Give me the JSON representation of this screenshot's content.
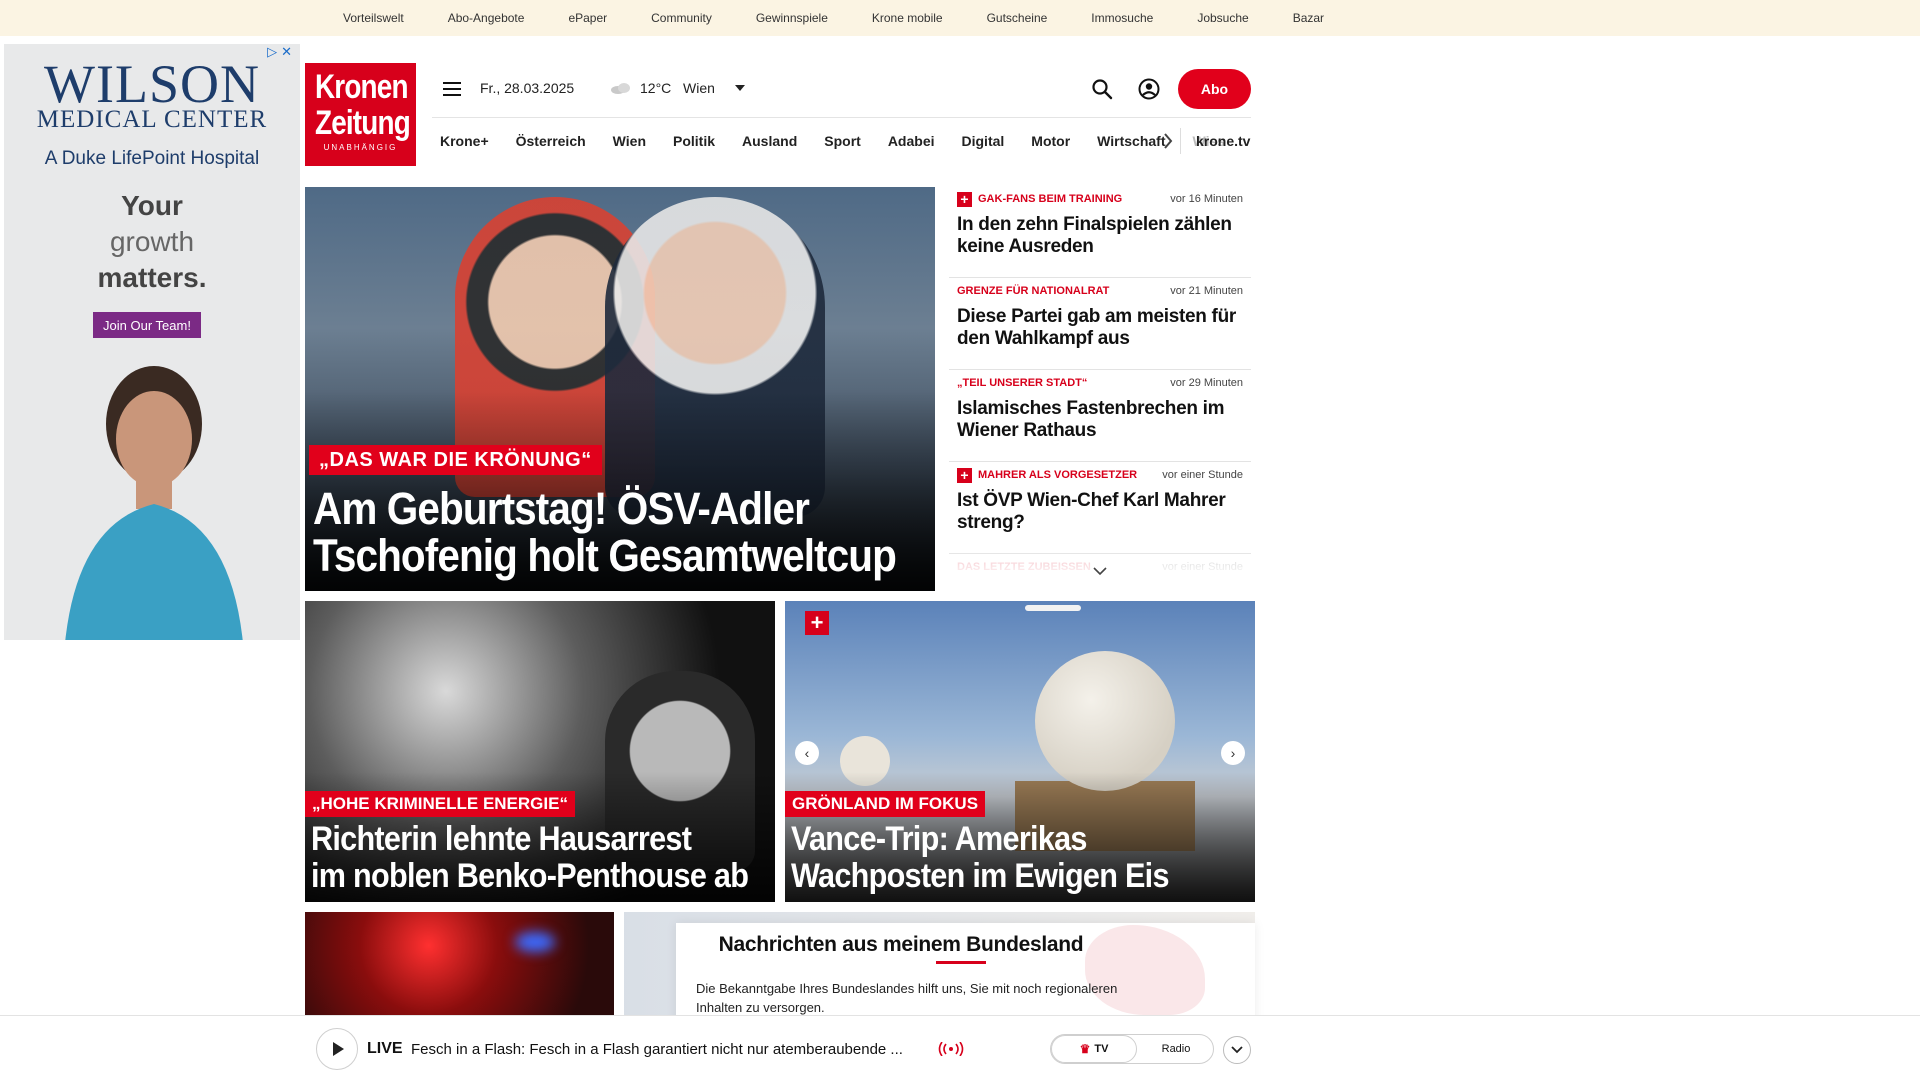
{
  "top_links": [
    "Vorteilswelt",
    "Abo-Angebote",
    "ePaper",
    "Community",
    "Gewinnspiele",
    "Krone mobile",
    "Gutscheine",
    "Immosuche",
    "Jobsuche",
    "Bazar"
  ],
  "ad": {
    "brand_line1": "WILSON",
    "brand_line2": "MEDICAL CENTER",
    "brand_line3": "A Duke LifePoint Hospital",
    "tagline_1": "Your",
    "tagline_2": "growth",
    "tagline_3": "matters.",
    "cta": "Join Our Team!",
    "close_glyphs": "▷✕"
  },
  "logo": {
    "line1": "Kronen",
    "line2": "Zeitung",
    "line3": "UNABHÄNGIG"
  },
  "header": {
    "date": "Fr., 28.03.2025",
    "temperature": "12°C",
    "city": "Wien",
    "abo_label": "Abo"
  },
  "nav": {
    "items": [
      "Krone+",
      "Österreich",
      "Wien",
      "Politik",
      "Ausland",
      "Sport",
      "Adabei",
      "Digital",
      "Motor",
      "Wirtschaft"
    ],
    "faded_item": "Wiss",
    "tv_link": "krone.tv"
  },
  "hero": {
    "kicker": "„DAS WAR DIE KRÖNUNG“",
    "headline_1": "Am Geburtstag! ÖSV-Adler",
    "headline_2": "Tschofenig holt Gesamtweltcup"
  },
  "ticker": [
    {
      "category": "GAK-FANS BEIM TRAINING",
      "plus": true,
      "time": "vor 16 Minuten",
      "title": "In den zehn Finalspielen zählen keine Ausreden"
    },
    {
      "category": "GRENZE FÜR NATIONALRAT",
      "plus": false,
      "time": "vor 21 Minuten",
      "title": "Diese Partei gab am meisten für den Wahlkampf aus"
    },
    {
      "category": "„TEIL UNSERER STADT“",
      "plus": false,
      "time": "vor 29 Minuten",
      "title": "Islamisches Fastenbrechen im Wiener Rathaus"
    },
    {
      "category": "MAHRER ALS VORGESETZER",
      "plus": true,
      "time": "vor einer Stunde",
      "title": "Ist ÖVP Wien-Chef Karl Mahrer streng?"
    },
    {
      "category": "DAS LETZTE ZUBEISSEN",
      "plus": false,
      "time": "vor einer Stunde",
      "title": ""
    }
  ],
  "tiles": [
    {
      "kicker": "„HOHE KRIMINELLE ENERGIE“",
      "headline_1": "Richterin lehnte Hausarrest",
      "headline_2": "im noblen Benko-Penthouse ab"
    },
    {
      "kicker": "GRÖNLAND IM FOKUS",
      "headline_1": "Vance-Trip: Amerikas",
      "headline_2": "Wachposten im Ewigen Eis",
      "plus_glyph": "+"
    }
  ],
  "carousel": {
    "prev": "‹",
    "next": "›"
  },
  "bundesland": {
    "title": "Nachrichten aus meinem Bundesland",
    "text": "Die Bekanntgabe Ihres Bundeslandes hilft uns, Sie mit noch regionaleren Inhalten zu versorgen."
  },
  "livebar": {
    "live_label": "LIVE",
    "text": "Fesch in a Flash: Fesch in a Flash garantiert nicht nur atemberaubende ...",
    "tv_label": "TV",
    "radio_label": "Radio"
  },
  "colors": {
    "brand_red": "#d7001b",
    "topbar_bg": "#fbf4e3",
    "ad_purple": "#7b2a85",
    "ad_navy": "#1e3d6b"
  }
}
